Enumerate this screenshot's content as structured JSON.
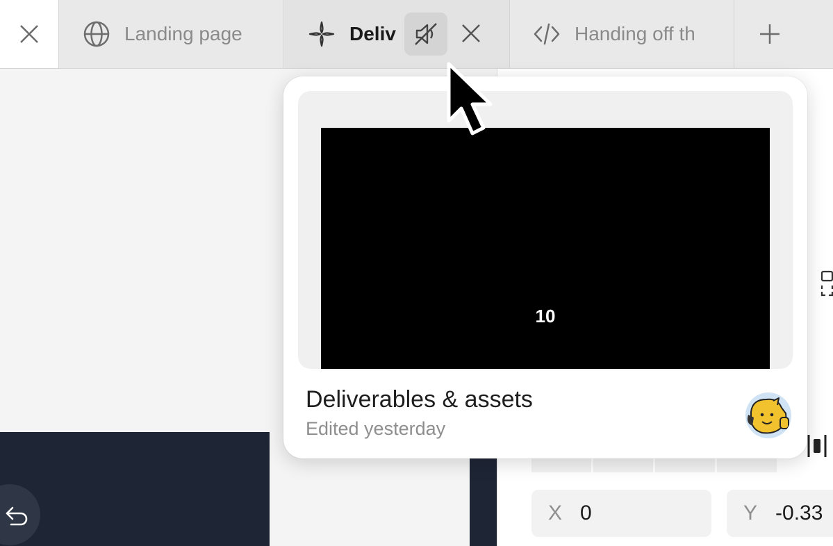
{
  "tabs": [
    {
      "label": "Landing page",
      "icon": "globe-icon"
    },
    {
      "label": "Deliverables & assets",
      "visible_label": "Deliv",
      "icon": "component-icon",
      "active": true
    },
    {
      "label": "Handing off th",
      "icon": "code-icon"
    }
  ],
  "hover_card": {
    "title": "Deliverables & assets",
    "subtitle": "Edited yesterday",
    "thumbnail_text": "10"
  },
  "properties": {
    "x_label": "X",
    "x_value": "0",
    "y_label": "Y",
    "y_value": "-0.33"
  },
  "colors": {
    "accent_dark": "#1e2535",
    "avatar_yellow": "#f2c22e"
  }
}
